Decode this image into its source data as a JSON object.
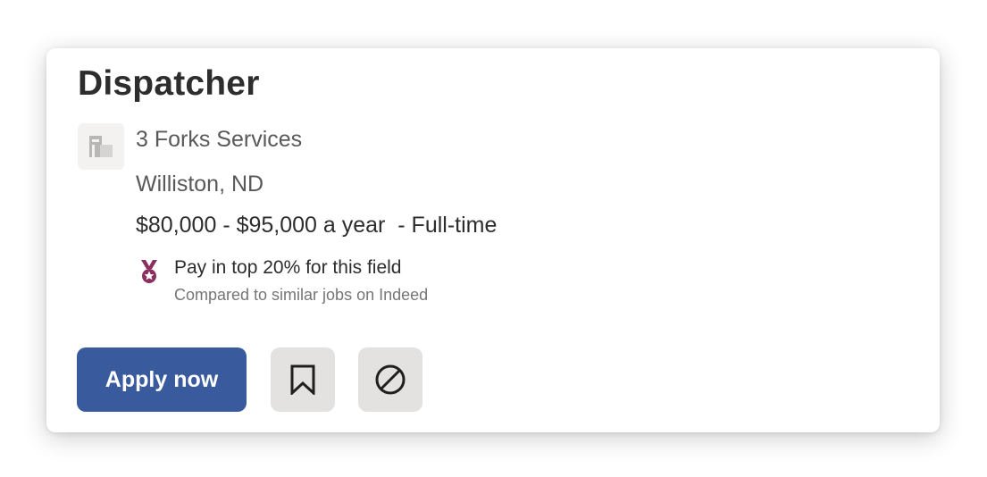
{
  "job": {
    "title": "Dispatcher",
    "company": "3 Forks Services",
    "location": "Williston, ND",
    "salary_line": "$80,000 - $95,000 a year  - Full-time"
  },
  "pay_badge": {
    "icon": "medal-icon",
    "title": "Pay in top 20% for this field",
    "subtitle": "Compared to similar jobs on Indeed",
    "color": "#8a2f5f"
  },
  "actions": {
    "apply_label": "Apply now",
    "apply_color": "#3a5a9e",
    "save_icon": "bookmark-icon",
    "not_interested_icon": "block-icon"
  },
  "company_logo": {
    "icon": "building-icon"
  }
}
